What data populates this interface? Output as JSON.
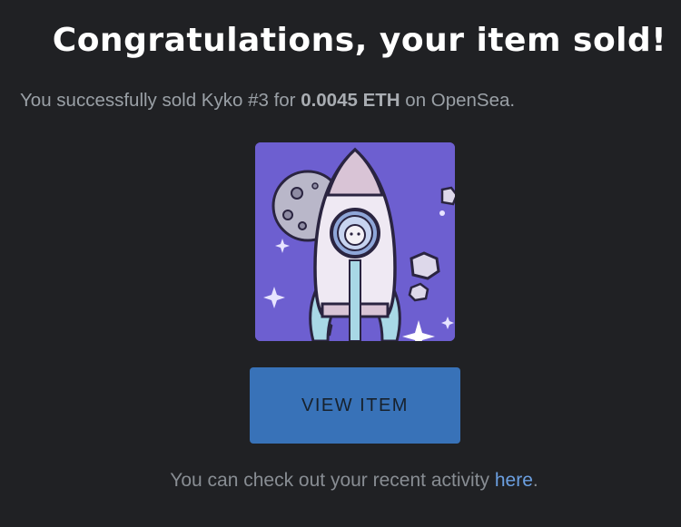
{
  "title": "Congratulations, your item sold!",
  "sale": {
    "prefix": "You successfully sold Kyko #3 for ",
    "price": "0.0045 ETH",
    "suffix": " on OpenSea."
  },
  "artwork": {
    "icon": "rocket-astronaut-artwork"
  },
  "actions": {
    "view_item_label": "VIEW ITEM"
  },
  "footer": {
    "text": "You can check out your recent activity ",
    "link_label": "here",
    "end": "."
  },
  "colors": {
    "background": "#202124",
    "button": "#3872b8",
    "link": "#6b9fe0",
    "artwork_bg": "#6d5fd0"
  }
}
